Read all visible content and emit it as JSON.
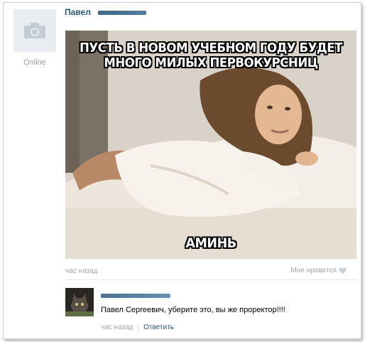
{
  "post": {
    "author_name": "Павел",
    "status": "Online",
    "meme_top_line1": "ПУСТЬ В НОВОМ УЧЕБНОМ ГОДУ БУДЕТ",
    "meme_top_line2": "МНОГО МИЛЫХ ПЕРВОКУРСНИЦ",
    "meme_bottom": "АМИНЬ",
    "time": "час назад",
    "like_label": "Мне нравится",
    "like_icon": "heart-icon"
  },
  "comment": {
    "text": "Павел Сергеевич, уберите это, вы же проректор!!!!",
    "time": "час назад",
    "separator": "|",
    "reply_label": "Ответить"
  },
  "colors": {
    "link": "#2b587a",
    "muted": "#a0a8b1",
    "avatar_placeholder_bg": "#e9edf1"
  }
}
